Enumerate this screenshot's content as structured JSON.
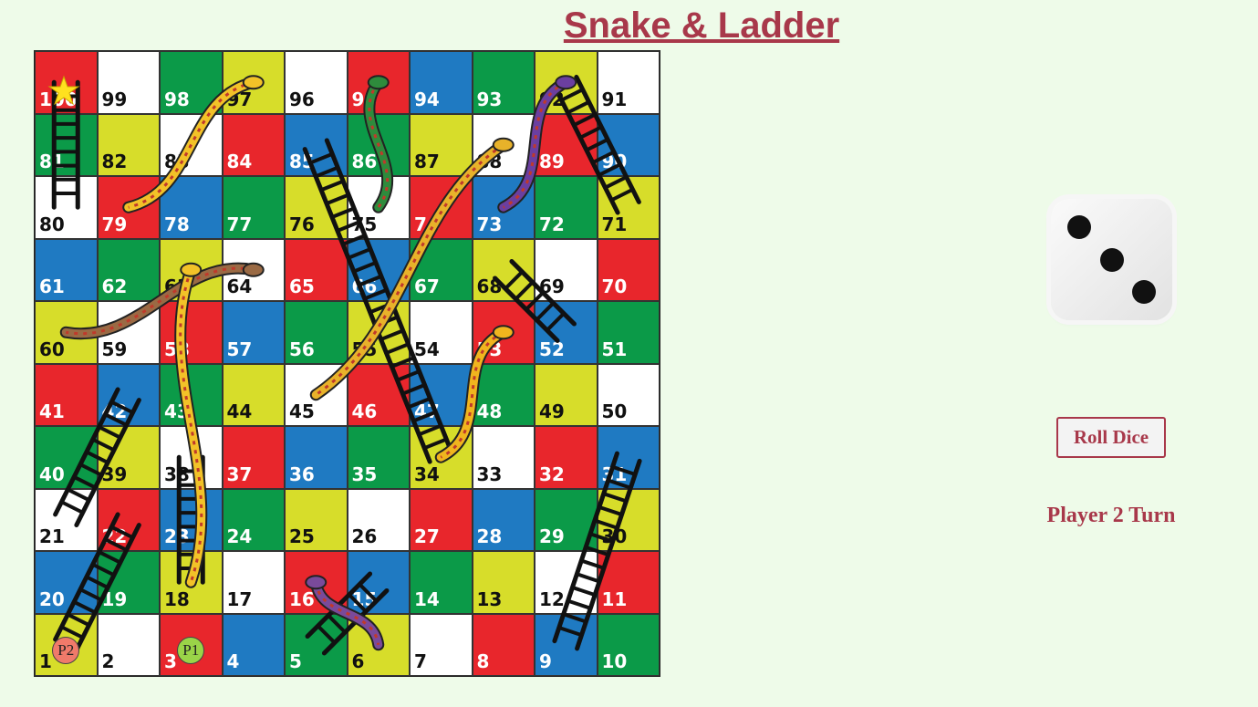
{
  "title": "Snake & Ladder",
  "board": {
    "colors": {
      "red": "#e8262c",
      "white": "#ffffff",
      "green": "#0b9a48",
      "yellow": "#d7dd2a",
      "blue": "#1f7ac2"
    },
    "rows": [
      [
        {
          "n": 100,
          "c": "red"
        },
        {
          "n": 99,
          "c": "white"
        },
        {
          "n": 98,
          "c": "green"
        },
        {
          "n": 97,
          "c": "yellow"
        },
        {
          "n": 96,
          "c": "white"
        },
        {
          "n": 95,
          "c": "red"
        },
        {
          "n": 94,
          "c": "blue"
        },
        {
          "n": 93,
          "c": "green"
        },
        {
          "n": 92,
          "c": "yellow"
        },
        {
          "n": 91,
          "c": "white"
        }
      ],
      [
        {
          "n": 81,
          "c": "green"
        },
        {
          "n": 82,
          "c": "yellow"
        },
        {
          "n": 83,
          "c": "white"
        },
        {
          "n": 84,
          "c": "red"
        },
        {
          "n": 85,
          "c": "blue"
        },
        {
          "n": 86,
          "c": "green"
        },
        {
          "n": 87,
          "c": "yellow"
        },
        {
          "n": 88,
          "c": "white"
        },
        {
          "n": 89,
          "c": "red"
        },
        {
          "n": 90,
          "c": "blue"
        }
      ],
      [
        {
          "n": 80,
          "c": "white"
        },
        {
          "n": 79,
          "c": "red"
        },
        {
          "n": 78,
          "c": "blue"
        },
        {
          "n": 77,
          "c": "green"
        },
        {
          "n": 76,
          "c": "yellow"
        },
        {
          "n": 75,
          "c": "white"
        },
        {
          "n": 74,
          "c": "red"
        },
        {
          "n": 73,
          "c": "blue"
        },
        {
          "n": 72,
          "c": "green"
        },
        {
          "n": 71,
          "c": "yellow"
        }
      ],
      [
        {
          "n": 61,
          "c": "blue"
        },
        {
          "n": 62,
          "c": "green"
        },
        {
          "n": 63,
          "c": "yellow"
        },
        {
          "n": 64,
          "c": "white"
        },
        {
          "n": 65,
          "c": "red"
        },
        {
          "n": 66,
          "c": "blue"
        },
        {
          "n": 67,
          "c": "green"
        },
        {
          "n": 68,
          "c": "yellow"
        },
        {
          "n": 69,
          "c": "white"
        },
        {
          "n": 70,
          "c": "red"
        }
      ],
      [
        {
          "n": 60,
          "c": "yellow"
        },
        {
          "n": 59,
          "c": "white"
        },
        {
          "n": 58,
          "c": "red"
        },
        {
          "n": 57,
          "c": "blue"
        },
        {
          "n": 56,
          "c": "green"
        },
        {
          "n": 55,
          "c": "yellow"
        },
        {
          "n": 54,
          "c": "white"
        },
        {
          "n": 53,
          "c": "red"
        },
        {
          "n": 52,
          "c": "blue"
        },
        {
          "n": 51,
          "c": "green"
        }
      ],
      [
        {
          "n": 41,
          "c": "red"
        },
        {
          "n": 42,
          "c": "blue"
        },
        {
          "n": 43,
          "c": "green"
        },
        {
          "n": 44,
          "c": "yellow"
        },
        {
          "n": 45,
          "c": "white"
        },
        {
          "n": 46,
          "c": "red"
        },
        {
          "n": 47,
          "c": "blue"
        },
        {
          "n": 48,
          "c": "green"
        },
        {
          "n": 49,
          "c": "yellow"
        },
        {
          "n": 50,
          "c": "white"
        }
      ],
      [
        {
          "n": 40,
          "c": "green"
        },
        {
          "n": 39,
          "c": "yellow"
        },
        {
          "n": 38,
          "c": "white"
        },
        {
          "n": 37,
          "c": "red"
        },
        {
          "n": 36,
          "c": "blue"
        },
        {
          "n": 35,
          "c": "green"
        },
        {
          "n": 34,
          "c": "yellow"
        },
        {
          "n": 33,
          "c": "white"
        },
        {
          "n": 32,
          "c": "red"
        },
        {
          "n": 31,
          "c": "blue"
        }
      ],
      [
        {
          "n": 21,
          "c": "white"
        },
        {
          "n": 22,
          "c": "red"
        },
        {
          "n": 23,
          "c": "blue"
        },
        {
          "n": 24,
          "c": "green"
        },
        {
          "n": 25,
          "c": "yellow"
        },
        {
          "n": 26,
          "c": "white"
        },
        {
          "n": 27,
          "c": "red"
        },
        {
          "n": 28,
          "c": "blue"
        },
        {
          "n": 29,
          "c": "green"
        },
        {
          "n": 30,
          "c": "yellow"
        }
      ],
      [
        {
          "n": 20,
          "c": "blue"
        },
        {
          "n": 19,
          "c": "green"
        },
        {
          "n": 18,
          "c": "yellow"
        },
        {
          "n": 17,
          "c": "white"
        },
        {
          "n": 16,
          "c": "red"
        },
        {
          "n": 15,
          "c": "blue"
        },
        {
          "n": 14,
          "c": "green"
        },
        {
          "n": 13,
          "c": "yellow"
        },
        {
          "n": 12,
          "c": "white"
        },
        {
          "n": 11,
          "c": "red"
        }
      ],
      [
        {
          "n": 1,
          "c": "yellow"
        },
        {
          "n": 2,
          "c": "white"
        },
        {
          "n": 3,
          "c": "red"
        },
        {
          "n": 4,
          "c": "blue"
        },
        {
          "n": 5,
          "c": "green"
        },
        {
          "n": 6,
          "c": "yellow"
        },
        {
          "n": 7,
          "c": "white"
        },
        {
          "n": 8,
          "c": "red"
        },
        {
          "n": 9,
          "c": "blue"
        },
        {
          "n": 10,
          "c": "green"
        }
      ]
    ],
    "ladders": [
      {
        "from": 1,
        "to": 22
      },
      {
        "from": 21,
        "to": 42
      },
      {
        "from": 18,
        "to": 38
      },
      {
        "from": 5,
        "to": 15
      },
      {
        "from": 9,
        "to": 31
      },
      {
        "from": 34,
        "to": 85
      },
      {
        "from": 52,
        "to": 68
      },
      {
        "from": 71,
        "to": 92
      },
      {
        "from": 80,
        "to": 100
      }
    ],
    "snakes": [
      {
        "head": 97,
        "tail": 79
      },
      {
        "head": 95,
        "tail": 75
      },
      {
        "head": 88,
        "tail": 45
      },
      {
        "head": 92,
        "tail": 73
      },
      {
        "head": 64,
        "tail": 60
      },
      {
        "head": 63,
        "tail": 18
      },
      {
        "head": 53,
        "tail": 34
      },
      {
        "head": 16,
        "tail": 6
      }
    ],
    "star_icon": "star-icon"
  },
  "tokens": [
    {
      "label": "P2",
      "color": "#f07a6a",
      "square": 1
    },
    {
      "label": "P1",
      "color": "#9ad448",
      "square": 3
    }
  ],
  "dice": {
    "value": 3
  },
  "controls": {
    "roll_label": "Roll Dice",
    "turn_text": "Player 2 Turn"
  },
  "colors": {
    "accent": "#a8384a",
    "background": "#eefbe9"
  }
}
